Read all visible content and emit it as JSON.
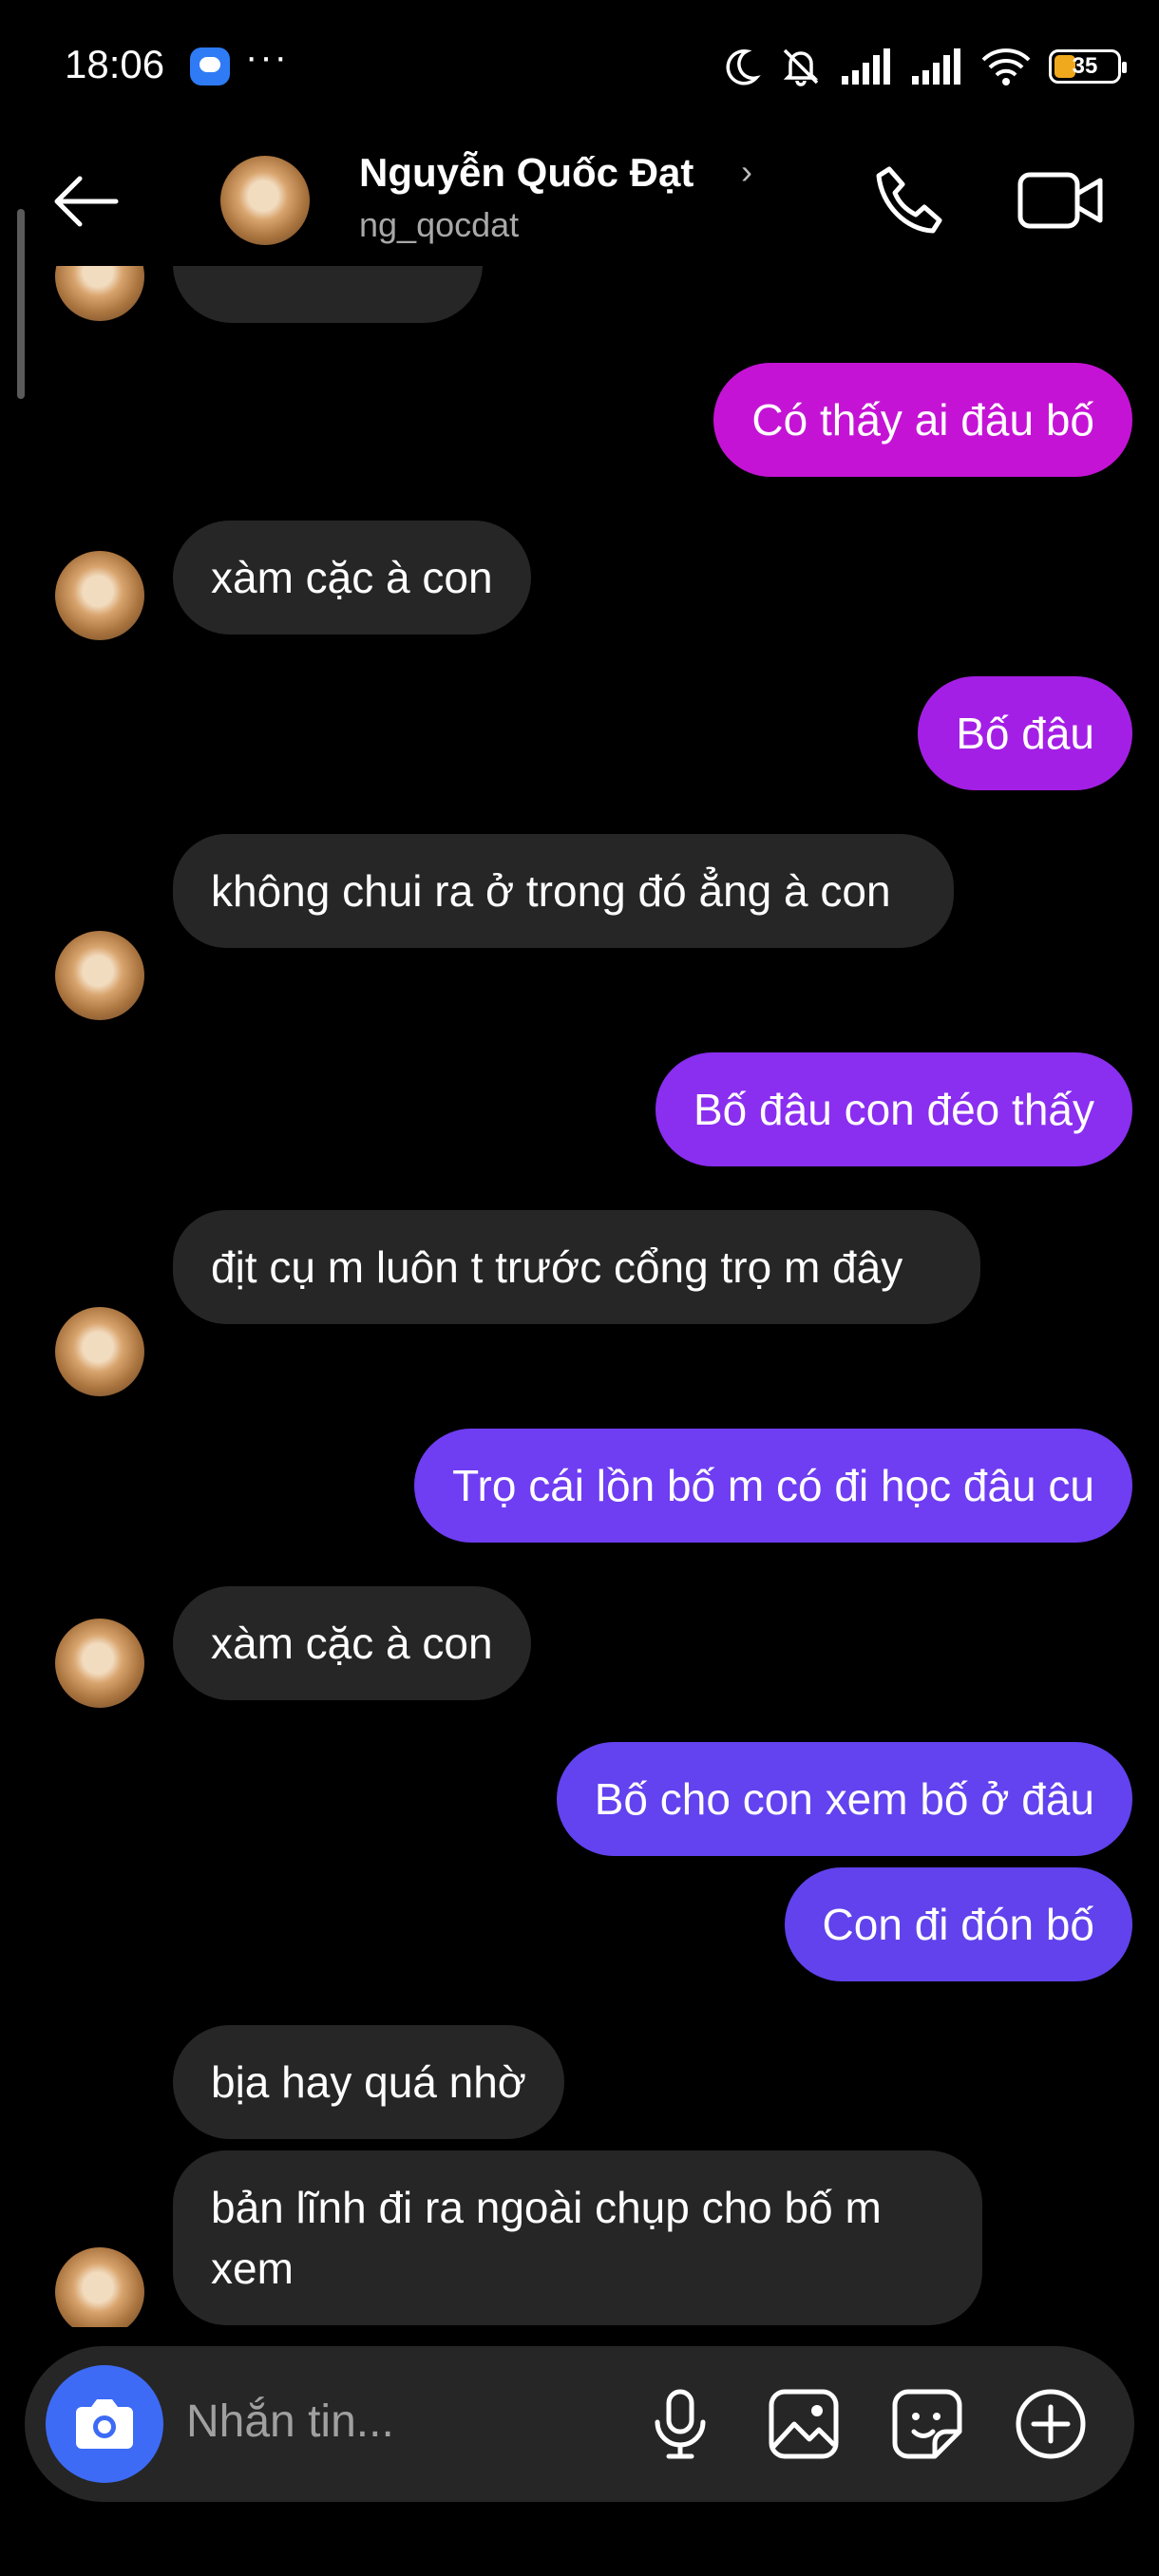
{
  "status_bar": {
    "time": "18:06",
    "more": "···",
    "battery": "35"
  },
  "header": {
    "name": "Nguyễn Quốc Đạt",
    "username": "ng_qocdat",
    "chevron": "›"
  },
  "messages": [
    {
      "dir": "out",
      "text": "Có thấy ai đâu bố",
      "color": "#c513d6"
    },
    {
      "dir": "in",
      "text": "xàm cặc à con"
    },
    {
      "dir": "out",
      "text": "Bố đâu",
      "color": "#a41fe6"
    },
    {
      "dir": "in",
      "text": "không chui ra ở trong đó ẳng à con"
    },
    {
      "dir": "out",
      "text": "Bố đâu con đéo thấy",
      "color": "#8a2ef0"
    },
    {
      "dir": "in",
      "text": "địt cụ m luôn t trước cổng trọ m đây"
    },
    {
      "dir": "out",
      "text": "Trọ cái lồn bố m có đi học đâu cu",
      "color": "#6f3df2"
    },
    {
      "dir": "in",
      "text": "xàm cặc à con"
    },
    {
      "dir": "out",
      "text": "Bố cho con xem bố ở đâu",
      "color": "#6342ef"
    },
    {
      "dir": "out",
      "text": "Con đi đón bố",
      "color": "#6142ec"
    },
    {
      "dir": "in",
      "text": "bịa hay quá nhờ"
    },
    {
      "dir": "in",
      "text": "bản lĩnh đi ra ngoài chụp cho bố m xem"
    }
  ],
  "composer": {
    "placeholder": "Nhắn tin..."
  },
  "icons": [
    "back-arrow-icon",
    "phone-icon",
    "video-camera-icon",
    "camera-icon",
    "microphone-icon",
    "gallery-icon",
    "sticker-icon",
    "plus-circle-icon",
    "moon-icon",
    "bell-off-icon",
    "signal-icon",
    "wifi-icon",
    "battery-icon"
  ]
}
